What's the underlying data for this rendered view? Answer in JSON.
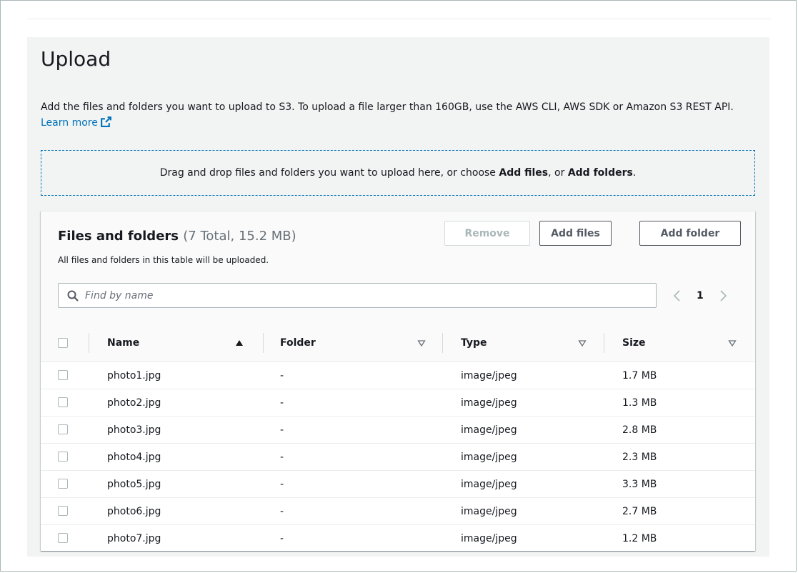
{
  "page": {
    "title": "Upload",
    "description": "Add the files and folders you want to upload to S3. To upload a file larger than 160GB, use the AWS CLI, AWS SDK or Amazon S3 REST API.",
    "learn_more": "Learn more"
  },
  "dropzone": {
    "text_before": "Drag and drop files and folders you want to upload here, or choose ",
    "add_files": "Add files",
    "text_mid": ", or ",
    "add_folders": "Add folders",
    "text_after": "."
  },
  "files_panel": {
    "title": "Files and folders",
    "count": "(7 Total, 15.2 MB)",
    "subtitle": "All files and folders in this table will be uploaded.",
    "buttons": {
      "remove": "Remove",
      "add_files": "Add files",
      "add_folder": "Add folder"
    },
    "search_placeholder": "Find by name",
    "current_page": "1",
    "columns": [
      "Name",
      "Folder",
      "Type",
      "Size"
    ],
    "rows": [
      {
        "name": "photo1.jpg",
        "folder": "-",
        "type": "image/jpeg",
        "size": "1.7 MB"
      },
      {
        "name": "photo2.jpg",
        "folder": "-",
        "type": "image/jpeg",
        "size": "1.3 MB"
      },
      {
        "name": "photo3.jpg",
        "folder": "-",
        "type": "image/jpeg",
        "size": "2.8 MB"
      },
      {
        "name": "photo4.jpg",
        "folder": "-",
        "type": "image/jpeg",
        "size": "2.3 MB"
      },
      {
        "name": "photo5.jpg",
        "folder": "-",
        "type": "image/jpeg",
        "size": "3.3 MB"
      },
      {
        "name": "photo6.jpg",
        "folder": "-",
        "type": "image/jpeg",
        "size": "2.7 MB"
      },
      {
        "name": "photo7.jpg",
        "folder": "-",
        "type": "image/jpeg",
        "size": "1.2 MB"
      }
    ]
  },
  "colors": {
    "link": "#0073bb",
    "text": "#16191f",
    "muted": "#687078",
    "panel_bg": "#f2f3f3"
  },
  "icons": {
    "learn_more": "external-link-icon",
    "search": "search-icon",
    "prev": "chevron-left-icon",
    "next": "chevron-right-icon",
    "sort_name": "sort-ascending-icon",
    "sort_other": "sort-descending-outline-icon"
  }
}
